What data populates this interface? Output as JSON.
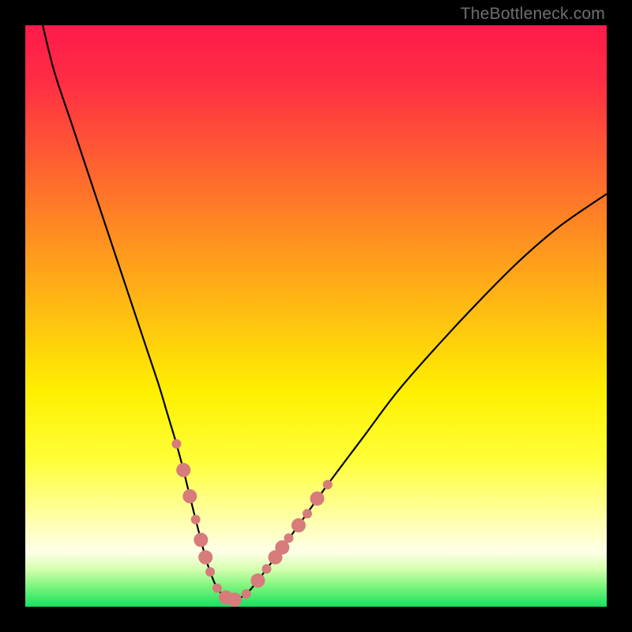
{
  "watermark": "TheBottleneck.com",
  "gradient": {
    "stops": [
      {
        "offset": 0.0,
        "color": "#ff1a4b"
      },
      {
        "offset": 0.1,
        "color": "#ff2e44"
      },
      {
        "offset": 0.22,
        "color": "#ff5a33"
      },
      {
        "offset": 0.35,
        "color": "#ff8a22"
      },
      {
        "offset": 0.5,
        "color": "#ffc011"
      },
      {
        "offset": 0.63,
        "color": "#fff000"
      },
      {
        "offset": 0.75,
        "color": "#ffff3a"
      },
      {
        "offset": 0.84,
        "color": "#ffffa0"
      },
      {
        "offset": 0.905,
        "color": "#ffffe8"
      },
      {
        "offset": 0.935,
        "color": "#d6ffb0"
      },
      {
        "offset": 0.965,
        "color": "#7cf57c"
      },
      {
        "offset": 1.0,
        "color": "#18e060"
      }
    ]
  },
  "chart_data": {
    "type": "line",
    "title": "",
    "xlabel": "",
    "ylabel": "",
    "xlim": [
      0,
      100
    ],
    "ylim": [
      0,
      100
    ],
    "series": [
      {
        "name": "bottleneck-curve",
        "x": [
          3,
          5,
          8,
          11,
          14,
          17,
          19,
          21,
          23,
          24.5,
          26,
          27.2,
          28.3,
          29.3,
          30.2,
          31,
          31.8,
          33,
          34.5,
          36,
          38,
          40,
          43,
          47,
          52,
          58,
          64,
          71,
          78,
          85,
          92,
          100
        ],
        "y": [
          100,
          92,
          83,
          74,
          65,
          56,
          50,
          44,
          38,
          33,
          28,
          23.5,
          19,
          15,
          11.5,
          8.5,
          6,
          3.2,
          1.6,
          1.2,
          2.2,
          4.5,
          8.5,
          14,
          21,
          29,
          37,
          45,
          52.5,
          59.5,
          65.5,
          71
        ]
      }
    ],
    "markers": {
      "name": "highlight-dots",
      "color": "#d77b7b",
      "radius_small": 6,
      "radius_large": 9,
      "points": [
        {
          "x": 26.0,
          "y": 28.0,
          "r": "small"
        },
        {
          "x": 27.2,
          "y": 23.5,
          "r": "large"
        },
        {
          "x": 28.3,
          "y": 19.0,
          "r": "large"
        },
        {
          "x": 29.3,
          "y": 15.0,
          "r": "small"
        },
        {
          "x": 30.2,
          "y": 11.5,
          "r": "large"
        },
        {
          "x": 31.0,
          "y": 8.5,
          "r": "large"
        },
        {
          "x": 31.8,
          "y": 6.0,
          "r": "small"
        },
        {
          "x": 33.0,
          "y": 3.2,
          "r": "small"
        },
        {
          "x": 34.5,
          "y": 1.6,
          "r": "large"
        },
        {
          "x": 36.0,
          "y": 1.2,
          "r": "large"
        },
        {
          "x": 38.0,
          "y": 2.2,
          "r": "small"
        },
        {
          "x": 40.0,
          "y": 4.5,
          "r": "large"
        },
        {
          "x": 41.5,
          "y": 6.5,
          "r": "small"
        },
        {
          "x": 43.0,
          "y": 8.5,
          "r": "large"
        },
        {
          "x": 44.2,
          "y": 10.2,
          "r": "large"
        },
        {
          "x": 45.3,
          "y": 11.8,
          "r": "small"
        },
        {
          "x": 47.0,
          "y": 14.0,
          "r": "large"
        },
        {
          "x": 48.5,
          "y": 16.0,
          "r": "small"
        },
        {
          "x": 50.2,
          "y": 18.6,
          "r": "large"
        },
        {
          "x": 52.0,
          "y": 21.0,
          "r": "small"
        }
      ]
    }
  }
}
